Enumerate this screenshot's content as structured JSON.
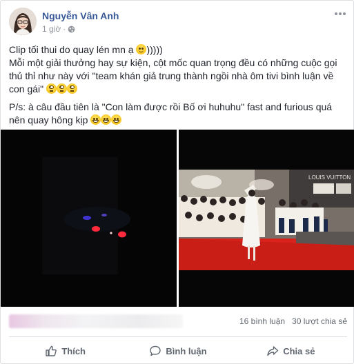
{
  "post": {
    "author": "Nguyễn Vân Anh",
    "time": "1 giờ",
    "privacy_icon": "globe-icon",
    "paragraphs": [
      {
        "text": "Clip tối thui do quay lén mn ạ",
        "trail": ")))))",
        "emoji": [
          "smile"
        ]
      },
      {
        "text": "Mỗi một giải thưởng hay sự kiện, cột mốc quan trọng đều có những cuộc gọi thủ thỉ như này với \"team khán giả trung thành ngồi nhà ôm tivi bình luận về con gái\"",
        "trail": "",
        "emoji": [
          "roll",
          "roll",
          "roll"
        ]
      },
      {
        "text": "P/s: à câu đầu tiên là \"Con làm được rồi Bố ơi huhuhu\" fast and furious quá nên quay hông kịp",
        "trail": "",
        "emoji": [
          "grin",
          "grin",
          "grin"
        ]
      }
    ]
  },
  "media": {
    "left_video": "dark-car-lights-video",
    "right_video": "red-carpet-crowd-video",
    "sign_text": "LOUIS VUITTON"
  },
  "stats": {
    "comments": "16 bình luận",
    "shares": "30 lượt chia sẻ"
  },
  "actions": {
    "like": "Thích",
    "comment": "Bình luận",
    "share": "Chia sẻ"
  },
  "colors": {
    "author": "#385898",
    "meta": "#90949c",
    "action": "#606770",
    "carpet": "#d8221b"
  }
}
